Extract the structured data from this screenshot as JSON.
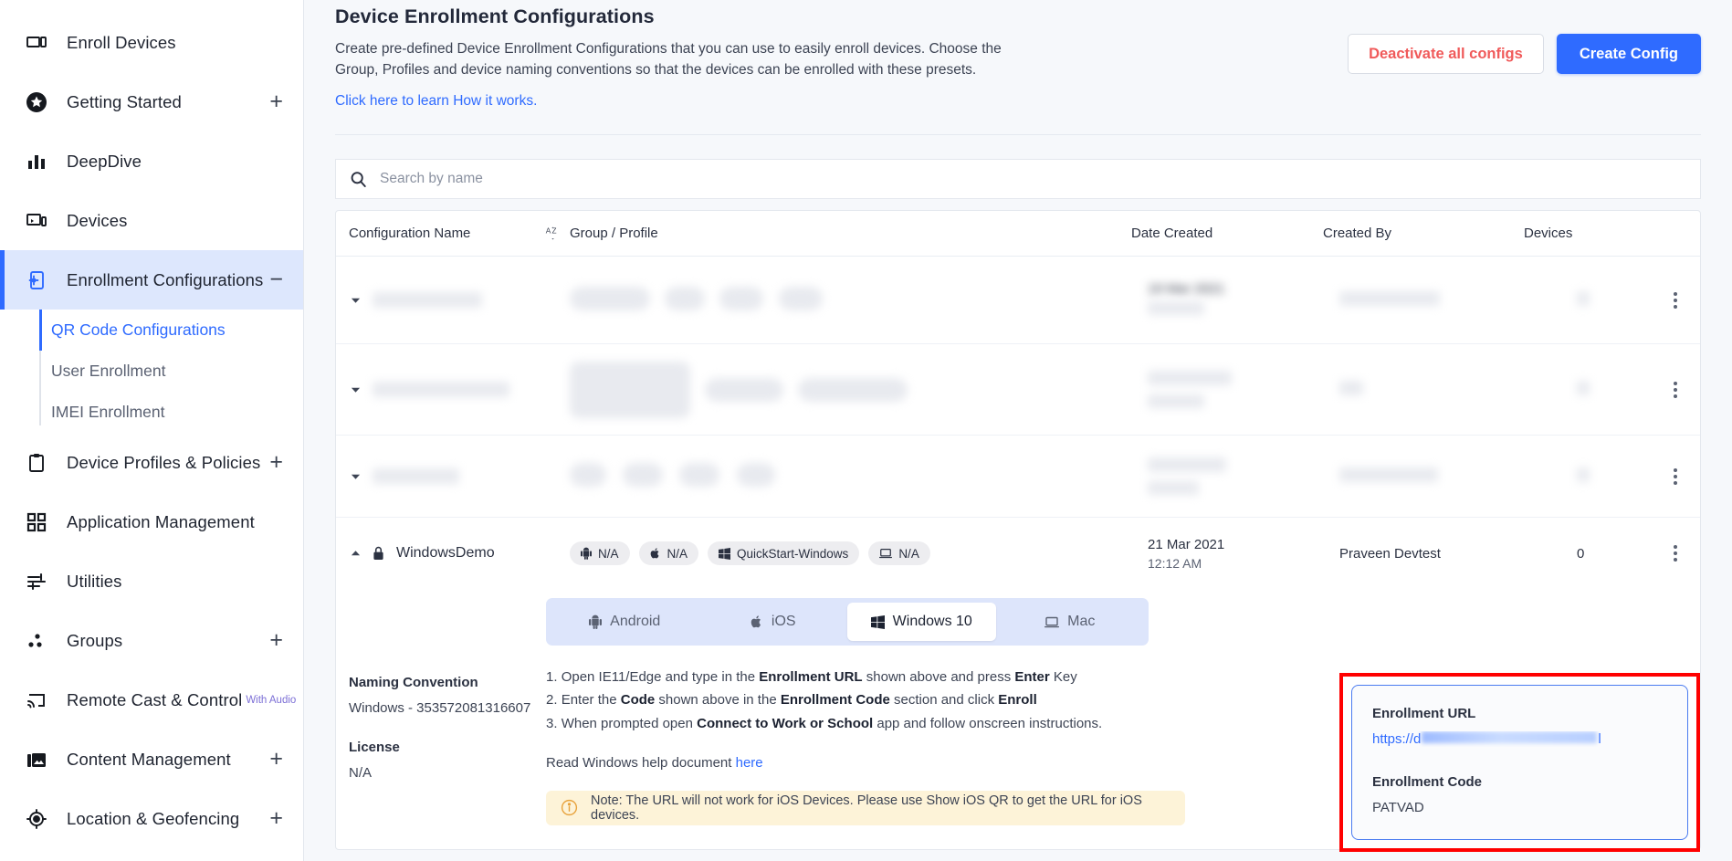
{
  "sidebar": {
    "items": [
      {
        "label": "Enroll Devices",
        "icon": "devices-outline-icon",
        "expandable": false,
        "active": false
      },
      {
        "label": "Getting Started",
        "icon": "star-icon",
        "expandable": true,
        "active": false
      },
      {
        "label": "DeepDive",
        "icon": "bar-chart-icon",
        "expandable": false,
        "active": false
      },
      {
        "label": "Devices",
        "icon": "monitor-phone-icon",
        "expandable": false,
        "active": false
      },
      {
        "label": "Enrollment Configurations",
        "icon": "enrollment-gear-icon",
        "expandable": true,
        "expanded": true,
        "active": true,
        "toggle": "−"
      },
      {
        "label": "Device Profiles & Policies",
        "icon": "clipboard-icon",
        "expandable": true,
        "active": false
      },
      {
        "label": "Application Management",
        "icon": "grid-apps-icon",
        "expandable": false,
        "active": false
      },
      {
        "label": "Utilities",
        "icon": "sliders-icon",
        "expandable": false,
        "active": false
      },
      {
        "label": "Groups",
        "icon": "groups-dots-icon",
        "expandable": true,
        "active": false
      },
      {
        "label": "Remote Cast & Control",
        "icon": "cast-icon",
        "expandable": false,
        "active": false,
        "superscript": "With Audio"
      },
      {
        "label": "Content Management",
        "icon": "images-icon",
        "expandable": true,
        "active": false
      },
      {
        "label": "Location & Geofencing",
        "icon": "location-target-icon",
        "expandable": true,
        "active": false
      }
    ],
    "expand_symbol": "+",
    "subitems": [
      {
        "label": "QR Code Configurations",
        "selected": true
      },
      {
        "label": "User Enrollment",
        "selected": false
      },
      {
        "label": "IMEI Enrollment",
        "selected": false
      }
    ]
  },
  "header": {
    "title": "Device Enrollment Configurations",
    "description": "Create pre-defined Device Enrollment Configurations that you can use to easily enroll devices. Choose the Group, Profiles and device naming conventions so that the devices can be enrolled with these presets.",
    "link": "Click here to learn How it works.",
    "deactivate_button": "Deactivate all configs",
    "create_button": "Create Config"
  },
  "search": {
    "placeholder": "Search by name",
    "value": ""
  },
  "table": {
    "columns": {
      "name": "Configuration Name",
      "group": "Group / Profile",
      "date": "Date Created",
      "created_by": "Created By",
      "devices": "Devices"
    },
    "sort_icon": "sort-alpha-icon",
    "redacted_rows": [
      {
        "date_partial": "19 Mar 2021"
      },
      {
        "date_partial": ""
      },
      {
        "date_partial": ""
      }
    ],
    "expanded_row": {
      "name": "WindowsDemo",
      "locked": true,
      "chips": [
        {
          "icon": "android-icon",
          "label": "N/A"
        },
        {
          "icon": "apple-icon",
          "label": "N/A"
        },
        {
          "icon": "windows-icon",
          "label": "QuickStart-Windows"
        },
        {
          "icon": "mac-laptop-icon",
          "label": "N/A"
        }
      ],
      "date_created": "21 Mar 2021",
      "time_created": "12:12 AM",
      "created_by": "Praveen Devtest",
      "devices": "0"
    }
  },
  "detail": {
    "os_tabs": [
      {
        "label": "Android",
        "icon": "android-icon",
        "selected": false
      },
      {
        "label": "iOS",
        "icon": "apple-icon",
        "selected": false
      },
      {
        "label": "Windows 10",
        "icon": "windows-icon",
        "selected": true
      },
      {
        "label": "Mac",
        "icon": "mac-laptop-icon",
        "selected": false
      }
    ],
    "naming_convention_label": "Naming Convention",
    "naming_convention_value": "Windows - 353572081316607",
    "license_label": "License",
    "license_value": "N/A",
    "steps": [
      {
        "n": "1.",
        "pre": "Open IE11/Edge and type in the ",
        "b1": "Enrollment URL",
        "mid": " shown above and press ",
        "b2": "Enter",
        "post": " Key"
      },
      {
        "n": "2.",
        "pre": "Enter the ",
        "b1": "Code",
        "mid": " shown above in the ",
        "b2": "Enrollment Code",
        "post": " section and click ",
        "b3": "Enroll"
      },
      {
        "n": "3.",
        "pre": "When prompted open ",
        "b1": "Connect to Work or School",
        "mid": " app and follow onscreen instructions.",
        "b2": "",
        "post": ""
      }
    ],
    "read_doc_text": "Read Windows help document ",
    "read_doc_link": "here",
    "note_icon": "info-circle-icon",
    "note_text": "Note: The URL will not work for iOS Devices. Please use Show iOS QR to get the URL for iOS devices."
  },
  "enrollment": {
    "url_label": "Enrollment URL",
    "url_prefix": "https://d",
    "url_suffix": "l",
    "url_redacted": true,
    "code_label": "Enrollment Code",
    "code_value": "PATVAD",
    "highlight_color": "#ff0000"
  },
  "colors": {
    "accent": "#2f6bff",
    "danger": "#f05a5a",
    "sidebar_active_bg": "#dde7fd",
    "page_bg": "#f6f8fb",
    "note_bg": "#fdf3d8"
  }
}
